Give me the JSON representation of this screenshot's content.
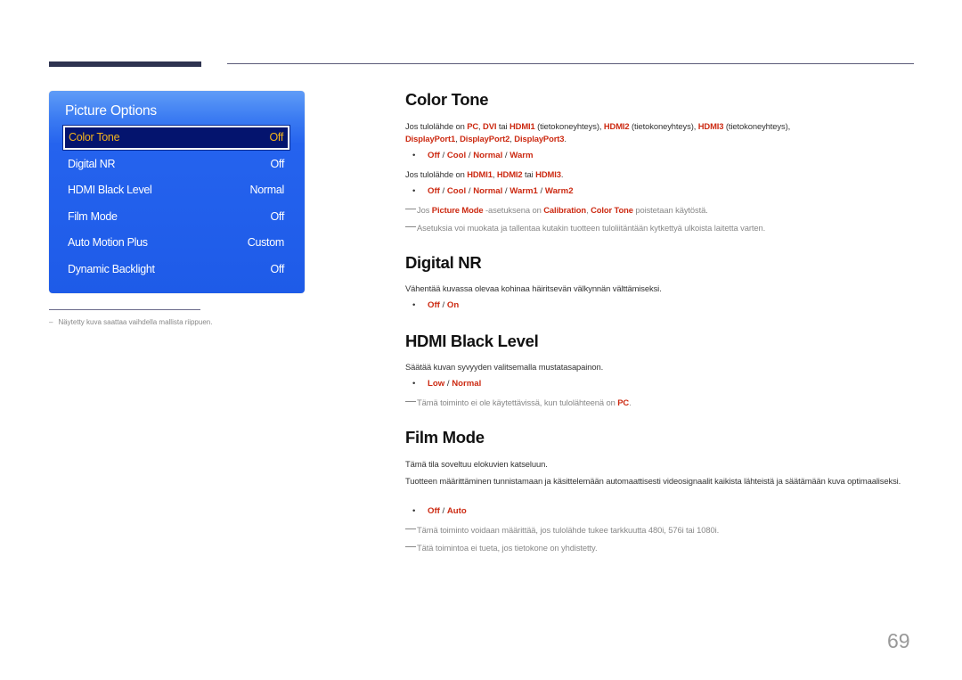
{
  "osd": {
    "title": "Picture Options",
    "items": [
      {
        "label": "Color Tone",
        "value": "Off"
      },
      {
        "label": "Digital NR",
        "value": "Off"
      },
      {
        "label": "HDMI Black Level",
        "value": "Normal"
      },
      {
        "label": "Film Mode",
        "value": "Off"
      },
      {
        "label": "Auto Motion Plus",
        "value": "Custom"
      },
      {
        "label": "Dynamic Backlight",
        "value": "Off"
      }
    ]
  },
  "footnote": {
    "dash": "–",
    "text": "Näytetty kuva saattaa vaihdella mallista riippuen."
  },
  "colors": {
    "accent": "#cc2a12",
    "osd_blue": "#1e5be8",
    "osd_selected": "#04146e",
    "osd_selected_text": "#f2b21b"
  },
  "sections": {
    "color_tone": {
      "title": "Color Tone",
      "p1": {
        "t1": "Jos tulolähde on ",
        "k1": "PC",
        "t2": ", ",
        "k2": "DVI",
        "t3": " tai ",
        "k3": "HDMI1",
        "t4": " (tietokoneyhteys), ",
        "k4": "HDMI2",
        "t5": " (tietokoneyhteys), ",
        "k5": "HDMI3",
        "t6": " (tietokoneyhteys), ",
        "k6": "DisplayPort1",
        "t7": ", ",
        "k7": "DisplayPort2",
        "t8": ", ",
        "k8": "DisplayPort3",
        "t9": "."
      },
      "opts1": [
        "Off",
        "Cool",
        "Normal",
        "Warm"
      ],
      "p2": {
        "t1": "Jos tulolähde on ",
        "k1": "HDMI1",
        "t2": ", ",
        "k2": "HDMI2",
        "t3": " tai ",
        "k3": "HDMI3",
        "t4": "."
      },
      "opts2": [
        "Off",
        "Cool",
        "Normal",
        "Warm1",
        "Warm2"
      ],
      "note1": {
        "t1": "Jos ",
        "k1": "Picture Mode",
        "t2": " -asetuksena on ",
        "k2": "Calibration",
        "t3": ", ",
        "k3": "Color Tone",
        "t4": " poistetaan käytöstä."
      },
      "note2": "Asetuksia voi muokata ja tallentaa kutakin tuotteen tuloliitäntään kytkettyä ulkoista laitetta varten."
    },
    "digital_nr": {
      "title": "Digital NR",
      "p1": "Vähentää kuvassa olevaa kohinaa häiritsevän välkynnän välttämiseksi.",
      "opts": [
        "Off",
        "On"
      ]
    },
    "hdmi_black": {
      "title": "HDMI Black Level",
      "p1": "Säätää kuvan syvyyden valitsemalla mustatasapainon.",
      "opts": [
        "Low",
        "Normal"
      ],
      "note1": {
        "t1": "Tämä toiminto ei ole käytettävissä, kun tulolähteenä on ",
        "k1": "PC",
        "t2": "."
      }
    },
    "film_mode": {
      "title": "Film Mode",
      "p1": "Tämä tila soveltuu elokuvien katseluun.",
      "p2": "Tuotteen määrittäminen tunnistamaan ja käsittelemään automaattisesti videosignaalit kaikista lähteistä ja säätämään kuva optimaaliseksi.",
      "opts": [
        "Off",
        "Auto"
      ],
      "note1": "Tämä toiminto voidaan määrittää, jos tulolähde tukee tarkkuutta 480i, 576i tai 1080i.",
      "note2": "Tätä toimintoa ei tueta, jos tietokone on yhdistetty."
    }
  },
  "separator": " / ",
  "bullet": "•",
  "page_number": "69"
}
